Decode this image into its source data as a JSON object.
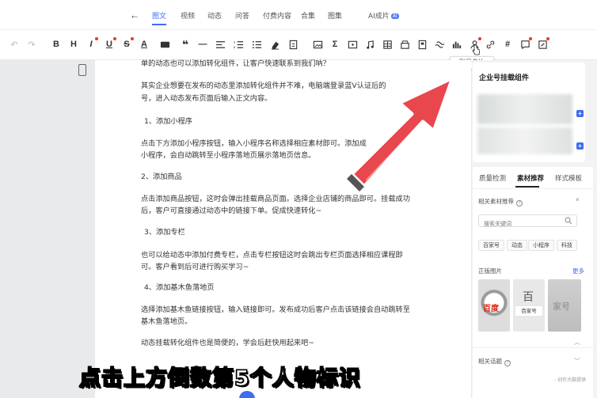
{
  "topnav": {
    "back": "←",
    "tabs": [
      "图文",
      "视频",
      "动态",
      "问答",
      "付费内容",
      "合集",
      "图集",
      "AI成片"
    ],
    "ai_badge": "AI"
  },
  "toolbar": {
    "undo": "↶",
    "redo": "↷",
    "bold": "B",
    "heading": "H",
    "italic": "I",
    "underline": "U",
    "strike": "S",
    "font_color": "A",
    "quote": "❝",
    "hr": "—",
    "sigma": "Σ",
    "hash": "#",
    "tooltip": "账号名片"
  },
  "editor": {
    "paragraphs": [
      "单的动态也可以添加转化组件，让客户快速联系到我们呐？",
      "其实企业想要在发布的动态里添加转化组件并不难，电脑端登录蓝V认证后的",
      "号，进入动态发布页面后输入正文内容。",
      "1、添加小程序",
      "点击下方添加小程序按钮，输入小程序名称选择相应素材即可。添加成",
      "小程序，会自动跳转至小程序落地页展示落地页信息。",
      "2、添加商品",
      "点击添加商品按钮，这时会弹出挂载商品页面。选择企业店铺的商品即可。挂载成功",
      "后，客户可直接通过动态中的链接下单。促成快速转化~",
      "3、添加专栏",
      "也可以给动态中添加付费专栏，点击专栏按钮这时会跳出专栏页面选择相应课程即",
      "可。客户看到后可进行购买学习~",
      "4、添加基木鱼落地页",
      "选择添加基木鱼链接按钮，输入链接即可。发布成功后客户点击该链接会自动跳转至",
      "基木鱼落地页。",
      "动态挂载转化组件也是简便的，学会后赶快用起来吧~"
    ]
  },
  "rpanel": {
    "card_title": "企业号挂载组件",
    "tabs": [
      "质量检测",
      "素材推荐",
      "样式模板"
    ],
    "related_label": "相关素材推荐",
    "help": "?",
    "close": "×",
    "search_placeholder": "搜索关键词",
    "chips": [
      "百家号",
      "动态",
      "小程序",
      "科技"
    ],
    "images_label": "正版图片",
    "more": "更多",
    "thumb1_text": "百度",
    "thumb2_glyph": "百",
    "thumb2_text": "百家号",
    "thumb3_text": "家号",
    "chevron": "︿",
    "related_topics": "相关话题",
    "footer": "- 创作大脑提供"
  },
  "subtitle": "点击上方倒数第5个人物标识",
  "colors": {
    "accent": "#3d6ef0",
    "arrow": "#e8474d"
  }
}
